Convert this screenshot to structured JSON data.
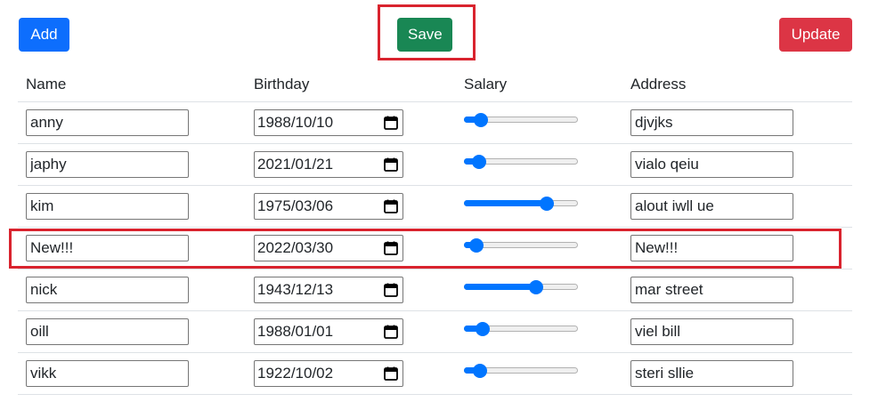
{
  "toolbar": {
    "add_label": "Add",
    "save_label": "Save",
    "update_label": "Update"
  },
  "table": {
    "headers": {
      "name": "Name",
      "birthday": "Birthday",
      "salary": "Salary",
      "address": "Address"
    },
    "rows": [
      {
        "name": "anny",
        "birthday": "1988/10/10",
        "salary_fraction": 0.1,
        "address": "djvjks"
      },
      {
        "name": "japhy",
        "birthday": "2021/01/21",
        "salary_fraction": 0.08,
        "address": "vialo qeiu"
      },
      {
        "name": "kim",
        "birthday": "1975/03/06",
        "salary_fraction": 0.76,
        "address": "alout iwll ue"
      },
      {
        "name": "New!!!",
        "birthday": "2022/03/30",
        "salary_fraction": 0.05,
        "address": "New!!!"
      },
      {
        "name": "nick",
        "birthday": "1943/12/13",
        "salary_fraction": 0.65,
        "address": "mar street"
      },
      {
        "name": "oill",
        "birthday": "1988/01/01",
        "salary_fraction": 0.12,
        "address": "viel bill"
      },
      {
        "name": "vikk",
        "birthday": "1922/10/02",
        "salary_fraction": 0.09,
        "address": "steri sllie"
      }
    ]
  },
  "colors": {
    "add": "#0d6efd",
    "save": "#198754",
    "update": "#dc3545",
    "highlight": "#d9232e",
    "slider": "#0075ff"
  },
  "icons": {
    "date_picker": "calendar-icon"
  }
}
